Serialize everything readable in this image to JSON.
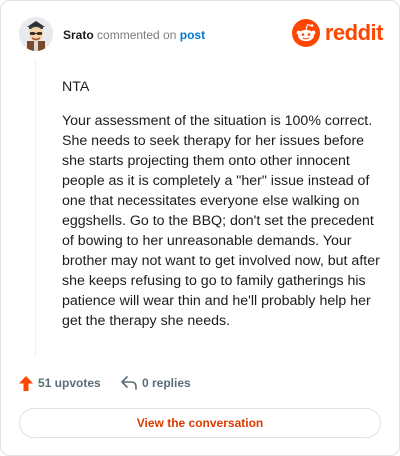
{
  "header": {
    "username": "Srato",
    "commented_text": "commented on",
    "post_link": "post",
    "brand_name": "reddit",
    "avatar_icon": "avatar-icon",
    "logo_icon": "reddit-snoo-icon"
  },
  "comment": {
    "paragraphs": [
      "NTA",
      "Your assessment of the situation is 100% correct. She needs to seek therapy for her issues before she starts projecting them onto other innocent people as it is completely a \"her\" issue instead of one that necessitates everyone else walking on eggshells. Go to the BBQ; don't set the precedent of bowing to her unreasonable demands. Your brother may not want to get involved now, but after she keeps refusing to go to family gatherings his patience will wear thin and he'll probably help her get the therapy she needs."
    ]
  },
  "actions": {
    "upvotes": "51 upvotes",
    "replies": "0 replies",
    "upvote_icon": "upvote-arrow-icon",
    "reply_icon": "reply-arrow-icon"
  },
  "cta": {
    "label": "View the conversation"
  },
  "colors": {
    "brand": "#ff4500",
    "link": "#0079d3",
    "muted": "#7c7c7c",
    "action": "#576f76",
    "cta_text": "#d93a00",
    "border": "#dfe1e3"
  }
}
